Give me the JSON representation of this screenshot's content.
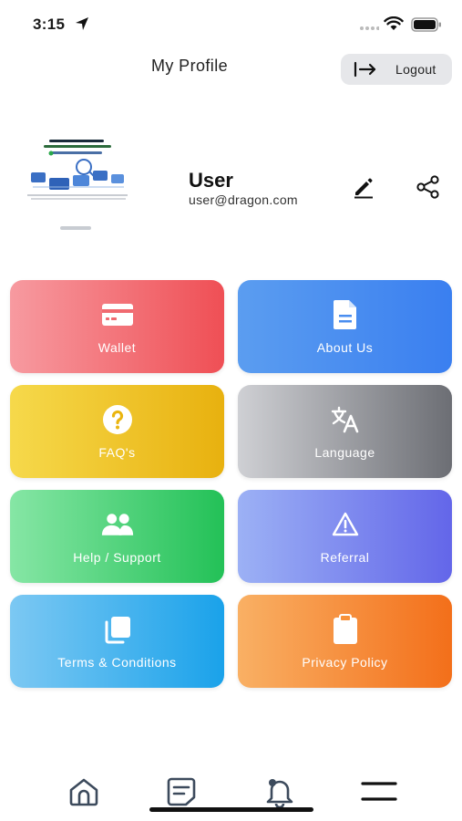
{
  "status_bar": {
    "time": "3:15"
  },
  "header": {
    "title": "My Profile",
    "logout_label": "Logout"
  },
  "profile": {
    "name": "User",
    "email": "user@dragon.com",
    "avatar_icon": "profile-image"
  },
  "tiles": [
    {
      "label": "Wallet",
      "icon": "credit-card-icon",
      "gradient": [
        "#f79aa0",
        "#ef4f55"
      ]
    },
    {
      "label": "About Us",
      "icon": "document-icon",
      "gradient": [
        "#5b9df0",
        "#3a7ff0"
      ]
    },
    {
      "label": "FAQ's",
      "icon": "question-circle-icon",
      "gradient": [
        "#f6d94b",
        "#e8b10f"
      ]
    },
    {
      "label": "Language",
      "icon": "translate-icon",
      "gradient": [
        "#cfd0d4",
        "#6c6e74"
      ]
    },
    {
      "label": "Help / Support",
      "icon": "users-icon",
      "gradient": [
        "#86e6a5",
        "#23c157"
      ]
    },
    {
      "label": "Referral",
      "icon": "warning-triangle-icon",
      "gradient": [
        "#9cb1f5",
        "#6366e9"
      ]
    },
    {
      "label": "Terms & Conditions",
      "icon": "copy-icon",
      "gradient": [
        "#7cc8f3",
        "#1aa2ea"
      ]
    },
    {
      "label": "Privacy Policy",
      "icon": "clipboard-icon",
      "gradient": [
        "#f9b064",
        "#f36f1a"
      ]
    }
  ],
  "bottom_nav": [
    "home-icon",
    "notes-icon",
    "bell-icon",
    "menu-icon"
  ],
  "colors": {
    "text_dark": "#222222",
    "logout_bg": "#e6e7ea",
    "icon_dark": "#2d3748"
  }
}
